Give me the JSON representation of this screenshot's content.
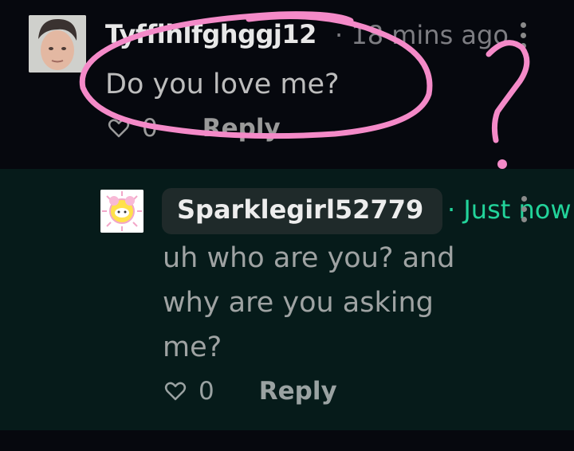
{
  "comments": [
    {
      "username": "Tyfflhlfghggj12",
      "time": "· 18 mins ago",
      "text": "Do you love me?",
      "likes": "0",
      "reply_label": "Reply"
    },
    {
      "username": "Sparklegirl52779",
      "time": "· Just now",
      "text": "uh who are you? and why are you asking me?",
      "likes": "0",
      "reply_label": "Reply"
    }
  ],
  "annotation": {
    "mark": "?",
    "color": "#f48ac8"
  },
  "icons": [
    "avatar-photo",
    "avatar-cartoon",
    "heart-icon",
    "more-vertical-icon"
  ],
  "colors": {
    "bg": "#06080e",
    "reply_bg": "#061b1a",
    "accent_time": "#22d39a",
    "pill": "#1f2a2a"
  }
}
